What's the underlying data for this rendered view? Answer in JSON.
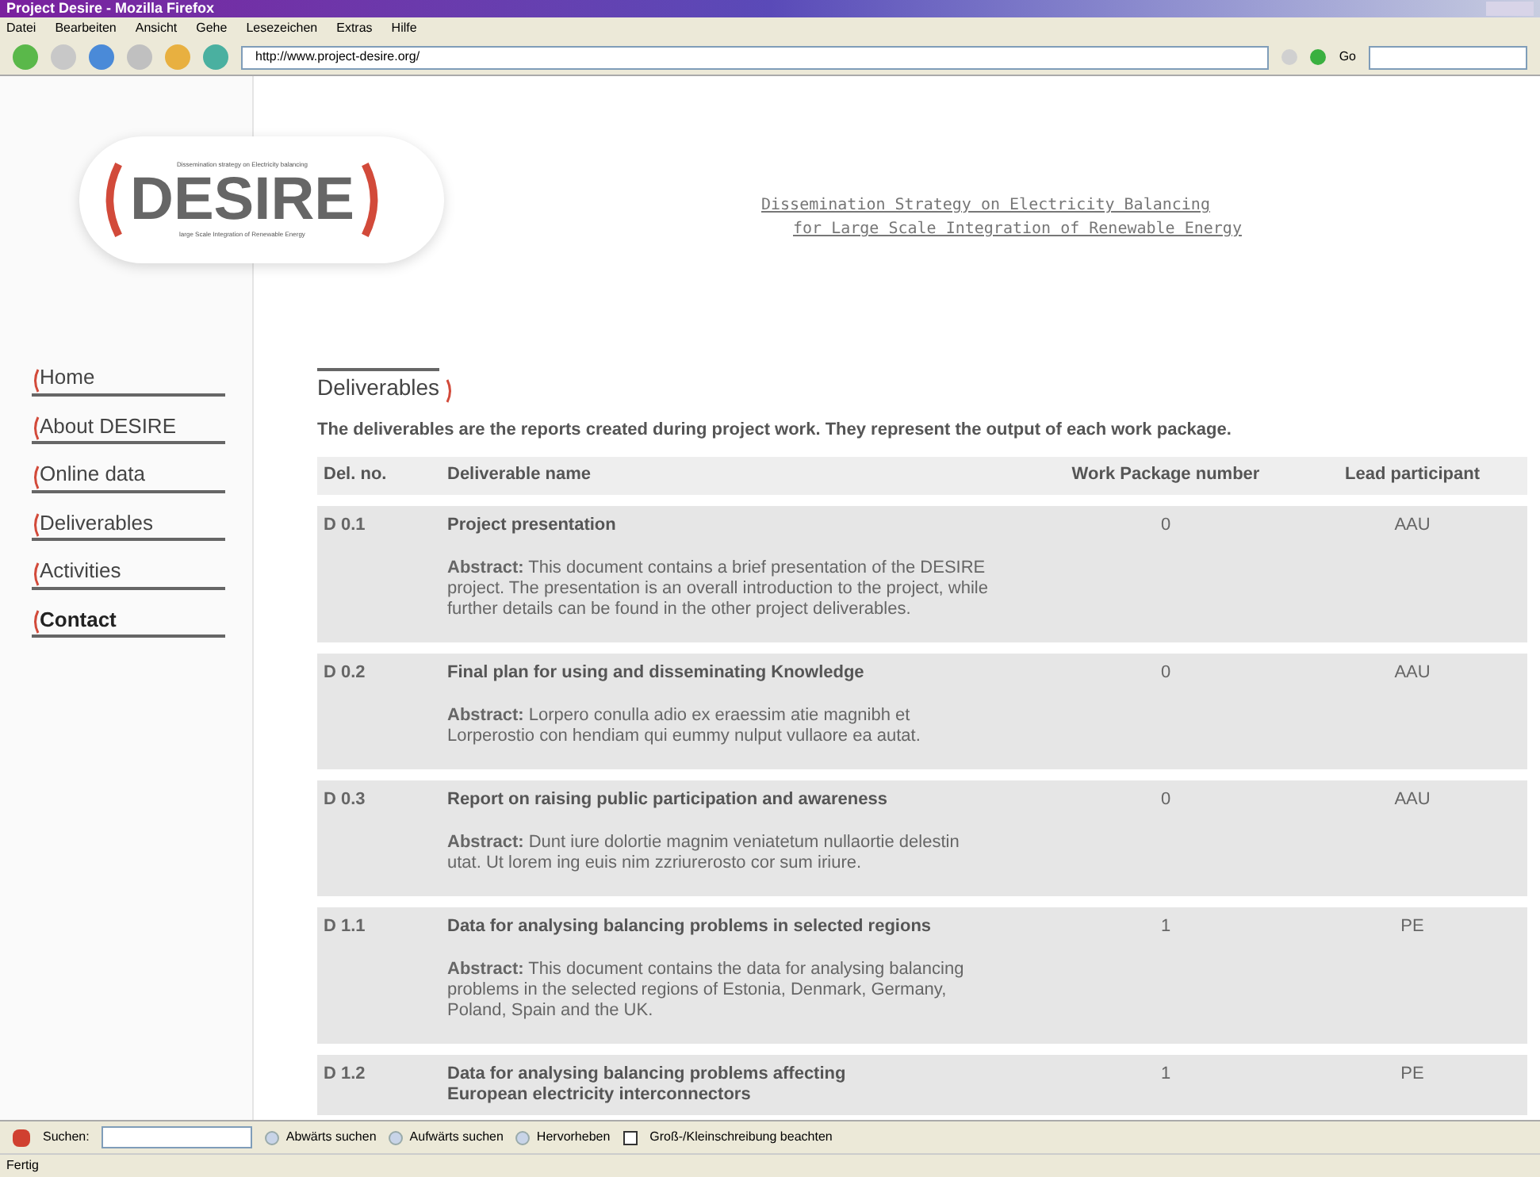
{
  "window": {
    "title": "Project Desire - Mozilla Firefox"
  },
  "menu": [
    "Datei",
    "Bearbeiten",
    "Ansicht",
    "Gehe",
    "Lesezeichen",
    "Extras",
    "Hilfe"
  ],
  "address": {
    "value": "http://www.project-desire.org/",
    "go": "Go"
  },
  "logo": {
    "top": "Dissemination strategy on Electricity balancing",
    "main": "DESIRE",
    "bottom": "large Scale Integration of Renewable Energy"
  },
  "tagline": [
    "Dissemination Strategy on Electricity Balancing",
    "for Large Scale Integration of Renewable Energy"
  ],
  "nav": [
    {
      "label": "Home",
      "selected": false
    },
    {
      "label": "About DESIRE",
      "selected": false
    },
    {
      "label": "Online data",
      "selected": false
    },
    {
      "label": "Deliverables",
      "selected": false
    },
    {
      "label": "Activities",
      "selected": false
    },
    {
      "label": "Contact",
      "selected": true
    }
  ],
  "heading": "Deliverables",
  "intro": "The deliverables are the reports created during project work. They represent the output of each work package.",
  "table": {
    "columns": [
      "Del. no.",
      "Deliverable name",
      "Work Package number",
      "Lead participant"
    ],
    "rows": [
      {
        "no": "D 0.1",
        "name": "Project presentation",
        "abstract": "**Abstract:** This document contains a brief presentation of the DESIRE project. The presentation is an overall introduction to the project, while further details can be found in the other project deliverables.",
        "wp": "0",
        "lead": "AAU"
      },
      {
        "no": "D 0.2",
        "name": "Final plan for using and disseminating Knowledge",
        "abstract": "**Abstract:** Lorpero conulla adio ex eraessim atie magnibh et Lorperostio con hendiam qui eummy nulput vullaore ea autat.",
        "wp": "0",
        "lead": "AAU"
      },
      {
        "no": "D 0.3",
        "name": "Report on raising public participation and awareness",
        "abstract": "**Abstract:** Dunt iure dolortie magnim veniatetum nullaortie delestin utat. Ut lorem ing euis nim zzriurerosto cor sum iriure.",
        "wp": "0",
        "lead": "AAU"
      },
      {
        "no": "D 1.1",
        "name": "Data for analysing balancing problems in selected regions",
        "abstract": "**Abstract:** This document contains the data for analysing balancing problems in the selected regions of Estonia, Denmark, Germany, Poland, Spain and the UK.",
        "wp": "1",
        "lead": "PE"
      },
      {
        "no": "D 1.2",
        "name": "Data for analysing balancing problems affecting European electricity interconnectors",
        "wp": "1",
        "lead": "PE"
      }
    ]
  },
  "findbar": {
    "label": "Suchen:",
    "buttons": [
      "Abwärts suchen",
      "Aufwärts suchen",
      "Hervorheben"
    ],
    "case": {
      "label": "Groß-/Kleinschreibung beachten",
      "checked": false
    }
  },
  "status": "Fertig"
}
